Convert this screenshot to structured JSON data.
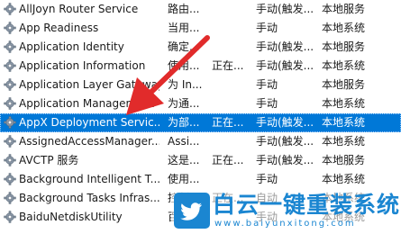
{
  "services": [
    {
      "name": "AllJoyn Router Service",
      "description": "路由...",
      "status": "",
      "startup": "手动(触发...",
      "logon": "本地服务",
      "selected": false
    },
    {
      "name": "App Readiness",
      "description": "当用...",
      "status": "",
      "startup": "手动",
      "logon": "本地系统",
      "selected": false
    },
    {
      "name": "Application Identity",
      "description": "确定...",
      "status": "",
      "startup": "手动(触发...",
      "logon": "本地服务",
      "selected": false
    },
    {
      "name": "Application Information",
      "description": "使用...",
      "status": "正在...",
      "startup": "手动(触发...",
      "logon": "本地系统",
      "selected": false
    },
    {
      "name": "Application Layer Gateway...",
      "description": "为 In...",
      "status": "",
      "startup": "手动",
      "logon": "本地服务",
      "selected": false
    },
    {
      "name": "Application Management",
      "description": "为通...",
      "status": "",
      "startup": "手动",
      "logon": "本地系统",
      "selected": false
    },
    {
      "name": "AppX Deployment Servic...",
      "description": "为部...",
      "status": "正在...",
      "startup": "手动(触发...",
      "logon": "本地系统",
      "selected": true
    },
    {
      "name": "AssignedAccessManager...",
      "description": "Assi...",
      "status": "",
      "startup": "手动(触发...",
      "logon": "本地系统",
      "selected": false
    },
    {
      "name": "AVCTP 服务",
      "description": "这是...",
      "status": "正在...",
      "startup": "手动(触发...",
      "logon": "本地服务",
      "selected": false
    },
    {
      "name": "Background Intelligent T...",
      "description": "使用...",
      "status": "",
      "startup": "手动",
      "logon": "本地系统",
      "selected": false
    },
    {
      "name": "Background Tasks Infras...",
      "description": "控制...",
      "status": "正在...",
      "startup": "自动",
      "logon": "本地系统",
      "selected": false
    },
    {
      "name": "BaiduNetdiskUtility",
      "description": "百度...",
      "status": "",
      "startup": "手动",
      "logon": "本地系统",
      "selected": false
    }
  ],
  "icons": {
    "service": "gear-icon",
    "arrow": "red-arrow-annotation",
    "watermark_logo": "twitter-bird-logo"
  },
  "colors": {
    "selected_bg": "#0078d7",
    "arrow": "#e12b2b",
    "watermark": "#1b86d1"
  },
  "watermark": {
    "title": "白云一键重装系统",
    "url": "www.baiyunxitong.com"
  }
}
